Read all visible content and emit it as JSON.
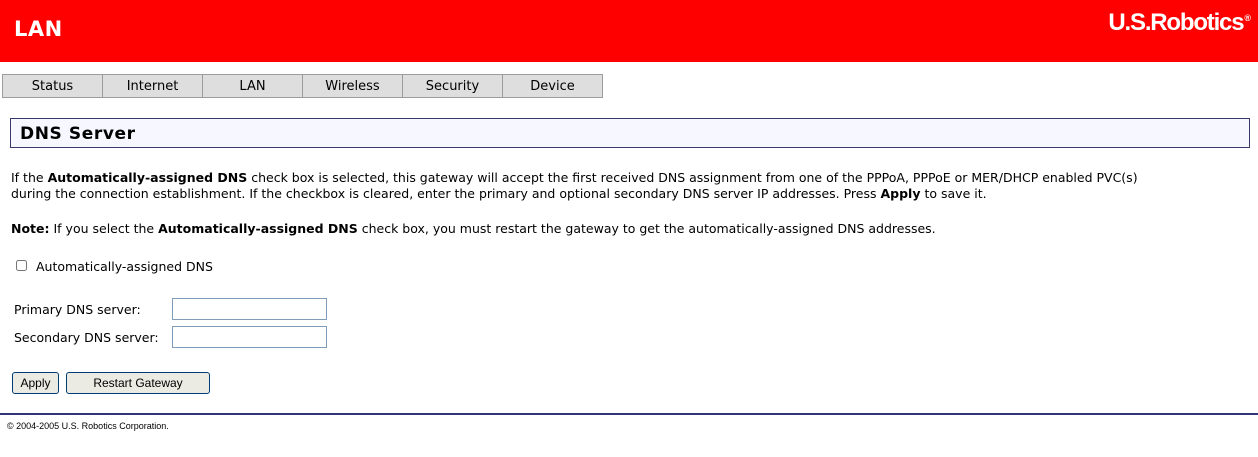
{
  "header": {
    "title": "LAN",
    "brand": "U.S.Robotics",
    "brand_mark": "®",
    "bg_color": "#ff0000"
  },
  "tabs": [
    {
      "label": "Status"
    },
    {
      "label": "Internet"
    },
    {
      "label": "LAN"
    },
    {
      "label": "Wireless"
    },
    {
      "label": "Security"
    },
    {
      "label": "Device"
    }
  ],
  "section": {
    "title": "DNS Server"
  },
  "description": {
    "line1_a": "If the ",
    "line1_b": "Automatically-assigned DNS",
    "line1_c": " check box is selected, this gateway will accept the first received DNS assignment from one of the PPPoA, PPPoE or MER/DHCP enabled PVC(s)",
    "line2_a": "during the connection establishment. If the checkbox is cleared, enter the primary and optional secondary DNS server IP addresses. Press ",
    "line2_b": "Apply",
    "line2_c": " to save it."
  },
  "note": {
    "label": "Note:",
    "text_a": " If you select the ",
    "text_b": "Automatically-assigned DNS",
    "text_c": " check box, you must restart the gateway to get the automatically-assigned DNS addresses."
  },
  "form": {
    "auto_dns_label": "Automatically-assigned DNS",
    "auto_dns_checked": false,
    "primary_label": "Primary DNS server:",
    "primary_value": "",
    "secondary_label": "Secondary DNS server:",
    "secondary_value": ""
  },
  "buttons": {
    "apply": "Apply",
    "restart": "Restart Gateway"
  },
  "footer": {
    "copyright": "© 2004-2005 U.S. Robotics Corporation."
  }
}
